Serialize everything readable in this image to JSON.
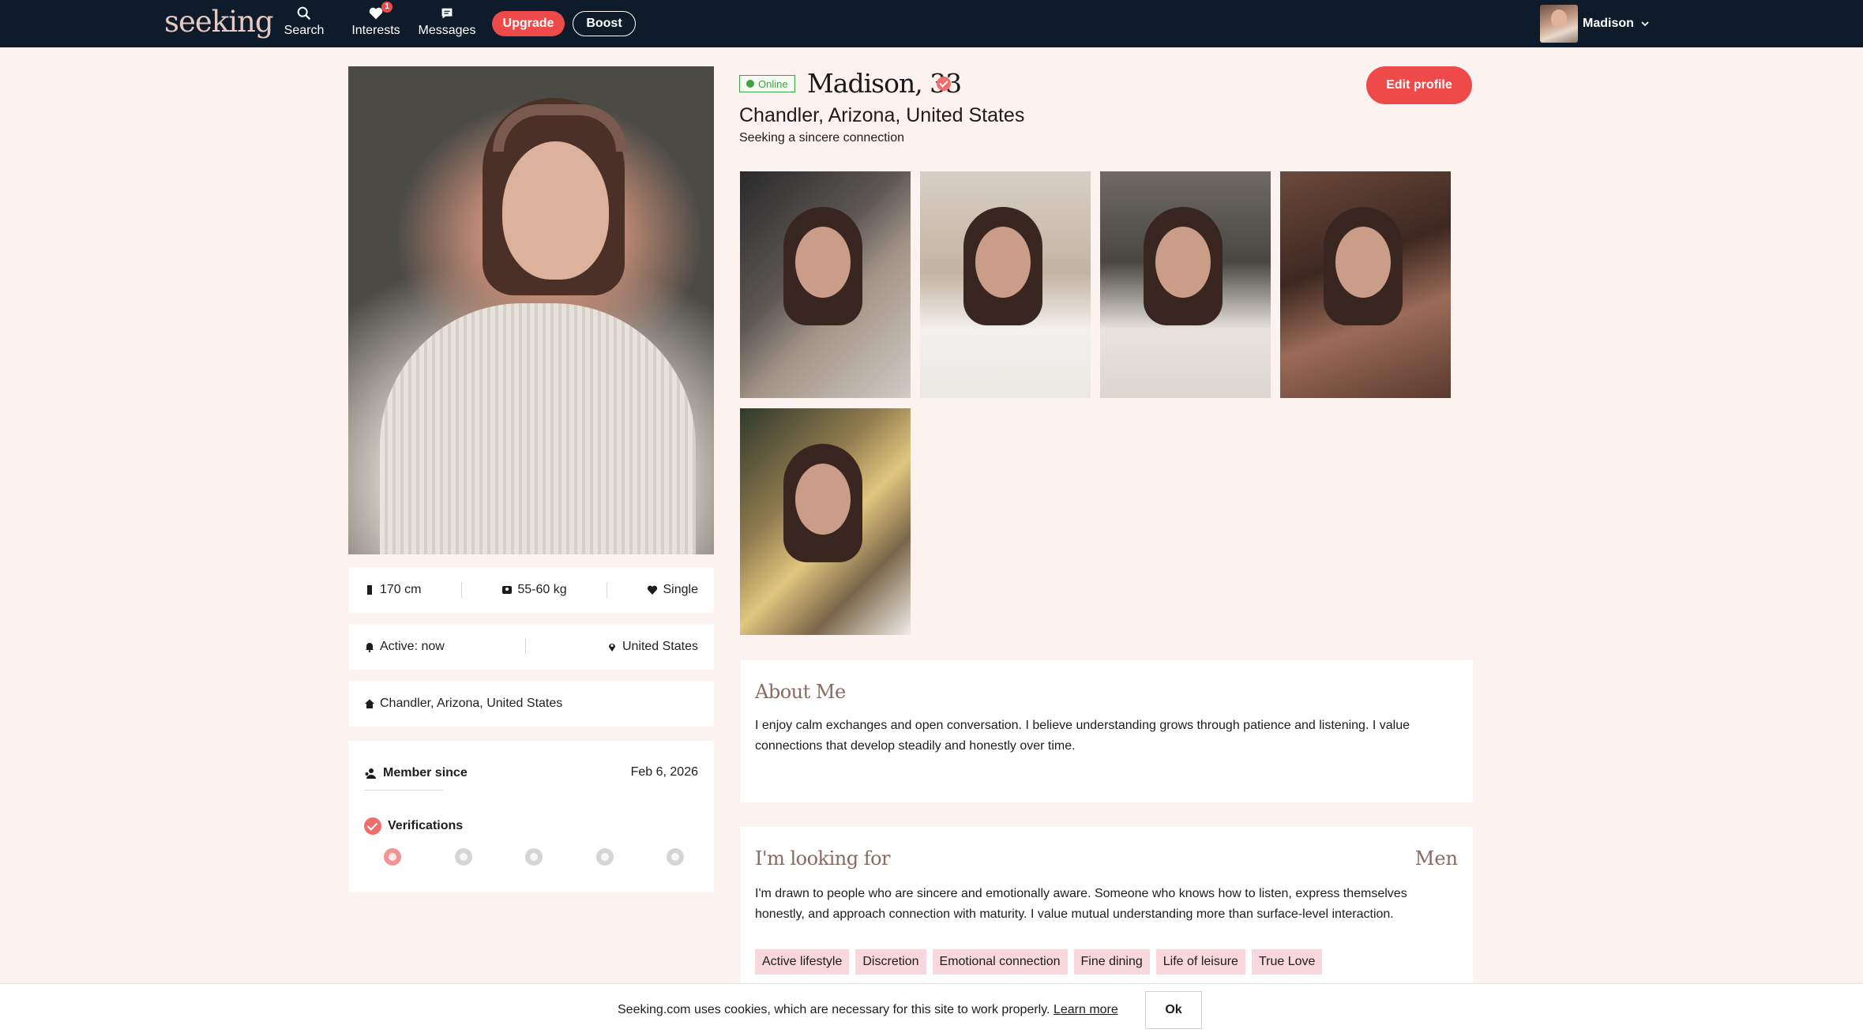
{
  "brand": {
    "logo": "seeking"
  },
  "nav": {
    "search": {
      "label": "Search",
      "icon": "search-icon"
    },
    "interests": {
      "label": "Interests",
      "icon": "heart-icon",
      "badge": "1"
    },
    "messages": {
      "label": "Messages",
      "icon": "message-icon"
    },
    "upgrade": "Upgrade",
    "boost": "Boost",
    "user": {
      "name": "Madison"
    }
  },
  "profile": {
    "status": "Online",
    "name": "Madison, 33",
    "location": "Chandler, Arizona, United States",
    "seeking": "Seeking a sincere connection",
    "edit_label": "Edit profile"
  },
  "stats": {
    "height": "170 cm",
    "weight": "55-60 kg",
    "relationship": "Single",
    "active": "Active: now",
    "country": "United States",
    "home": "Chandler, Arizona, United States"
  },
  "member": {
    "label": "Member since",
    "date": "Feb 6, 2026",
    "verifications_label": "Verifications",
    "verification_icons": [
      "photo-verified-icon",
      "profile-icon",
      "id-icon",
      "facebook-icon",
      "linkedin-icon"
    ]
  },
  "about": {
    "title": "About Me",
    "text": "I enjoy calm exchanges and open conversation. I believe understanding grows through patience and listening. I value connections that develop steadily and honestly over time."
  },
  "looking_for": {
    "title": "I'm looking for",
    "gender": "Men",
    "text": "I'm drawn to people who are sincere and emotionally aware. Someone who knows how to listen, express themselves honestly, and approach connection with maturity. I value mutual understanding more than surface-level interaction.",
    "tags": [
      "Active lifestyle",
      "Discretion",
      "Emotional connection",
      "Fine dining",
      "Life of leisure",
      "True Love"
    ]
  },
  "cookie": {
    "text": "Seeking.com uses cookies, which are necessary for this site to work properly.",
    "link": "Learn more",
    "ok": "Ok"
  },
  "colors": {
    "nav_bg": "#0d1b2b",
    "accent": "#ef4a4a",
    "page_bg": "#fcf2f0",
    "tag_bg": "#f8d7dd",
    "online": "#43a047"
  }
}
